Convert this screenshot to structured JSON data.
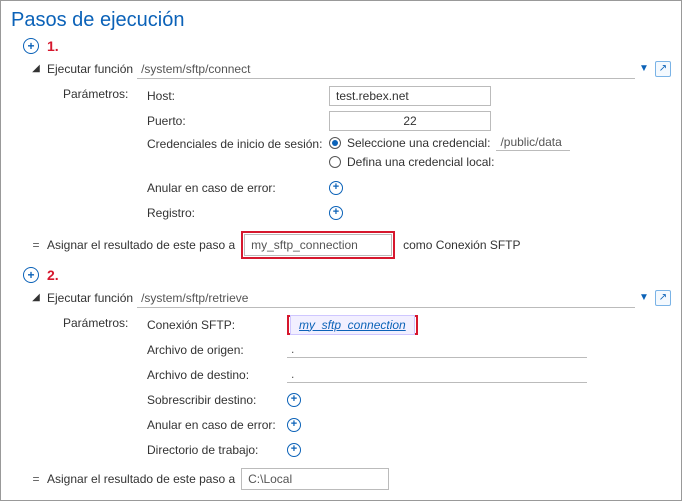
{
  "title": "Pasos de ejecución",
  "step1_num": "1.",
  "step2_num": "2.",
  "func_label": "Ejecutar función",
  "params_label": "Parámetros:",
  "assign_label": "Asignar el resultado de este paso a",
  "assign_suffix": "como Conexión SFTP",
  "s1": {
    "path": "/system/sftp/connect",
    "host_key": "Host:",
    "host_val": "test.rebex.net",
    "port_key": "Puerto:",
    "port_val": "22",
    "cred_key": "Credenciales de inicio de sesión:",
    "cred_opt1": "Seleccione una credencial:",
    "cred_opt2": "Defina una credencial local:",
    "cred_path": "/public/data",
    "abort_key": "Anular en caso de error:",
    "log_key": "Registro:",
    "result_var": "my_sftp_connection"
  },
  "s2": {
    "path": "/system/sftp/retrieve",
    "conn_key": "Conexión SFTP:",
    "conn_val": "my_sftp_connection",
    "src_key": "Archivo de origen:",
    "dst_key": "Archivo de destino:",
    "ovw_key": "Sobrescribir destino:",
    "abort_key": "Anular en caso de error:",
    "wd_key": "Directorio de trabajo:",
    "dot": ".",
    "result_var": "C:\\Local"
  }
}
